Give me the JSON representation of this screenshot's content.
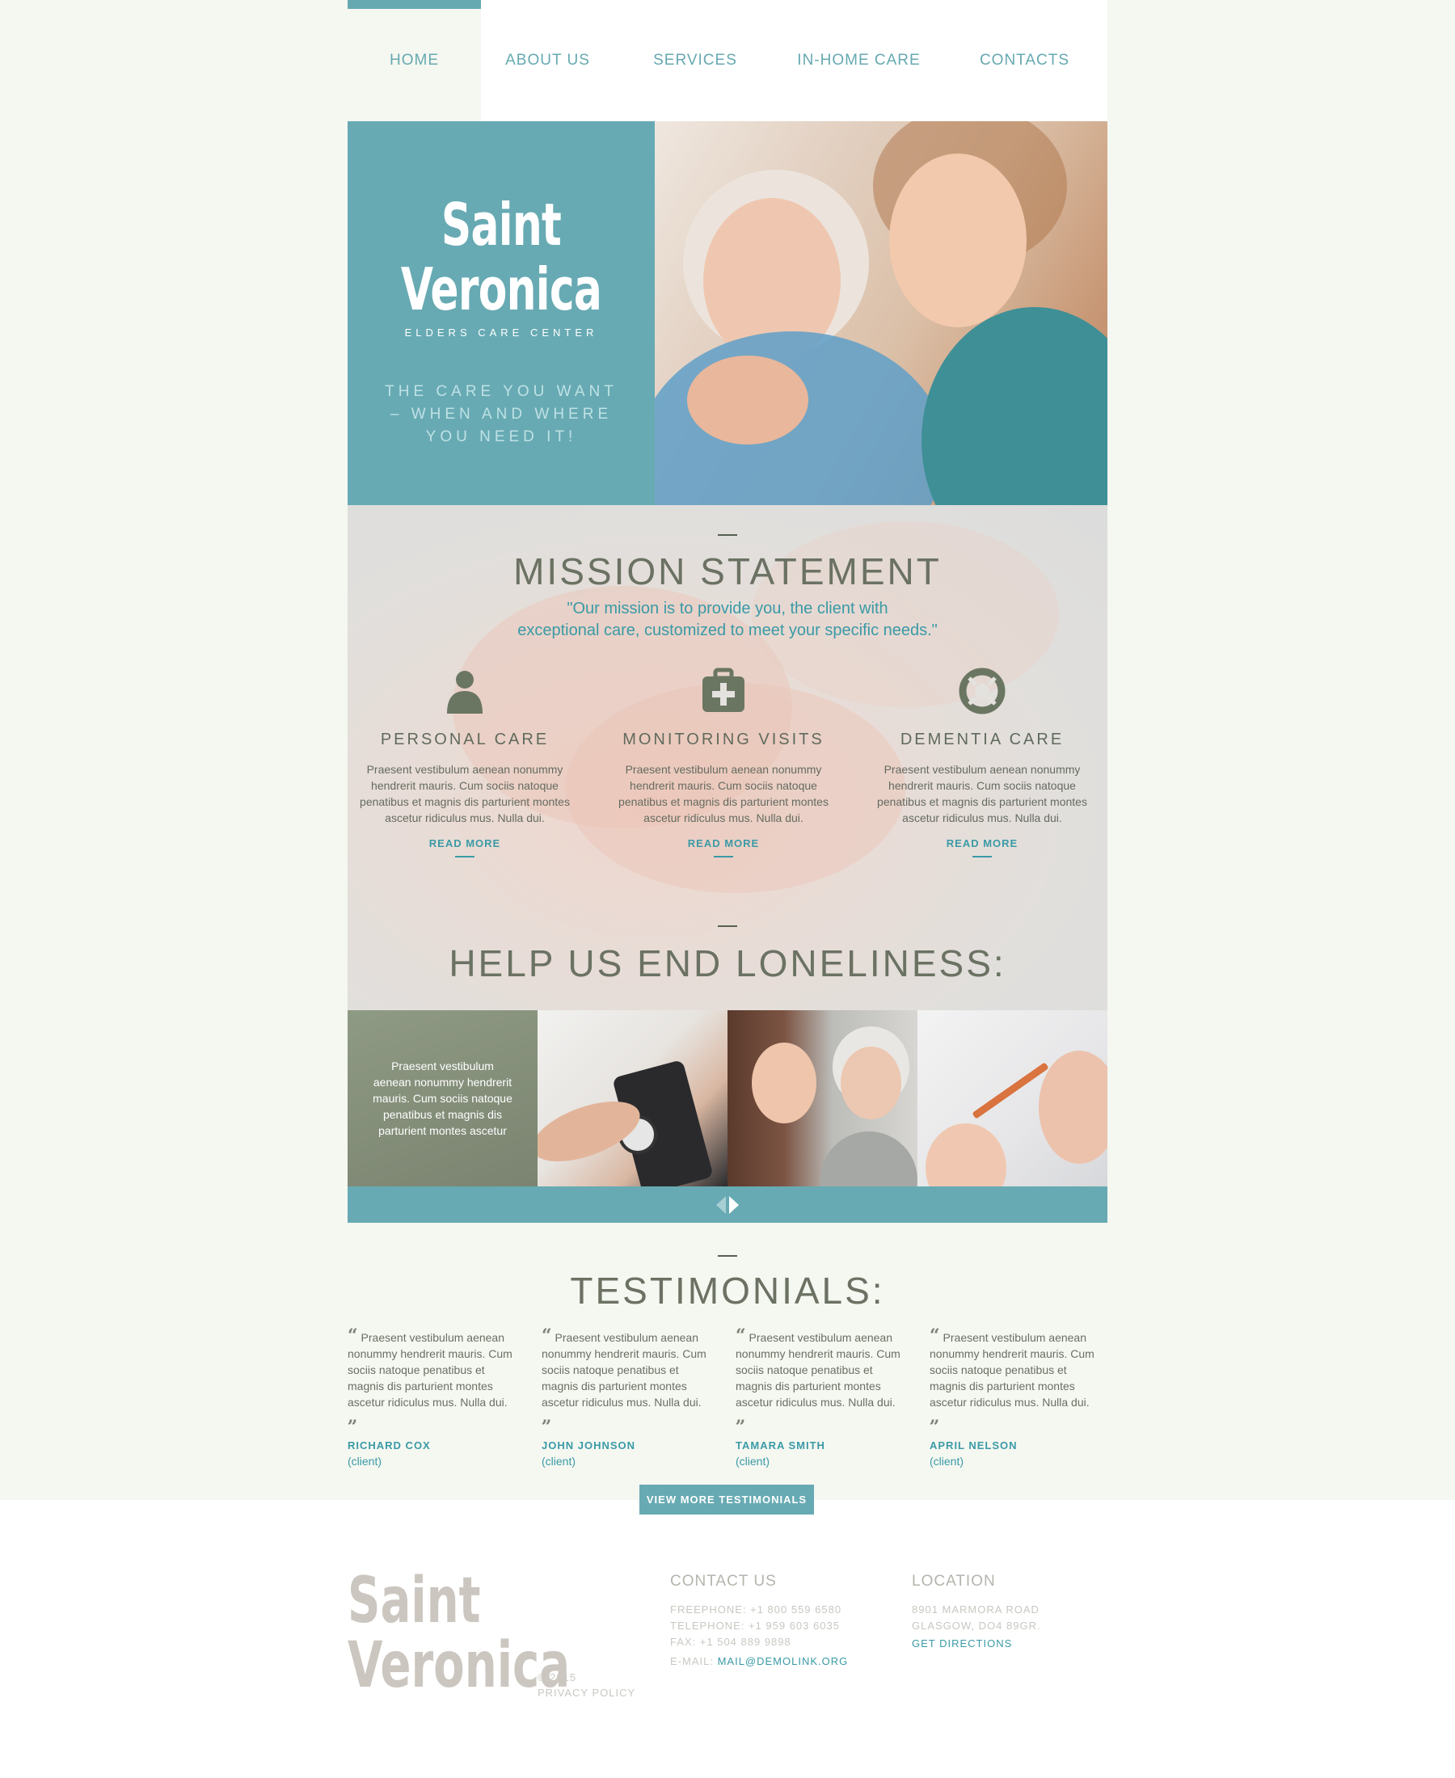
{
  "nav": {
    "items": [
      {
        "label": "HOME"
      },
      {
        "label": "ABOUT US"
      },
      {
        "label": "SERVICES"
      },
      {
        "label": "IN-HOME CARE"
      },
      {
        "label": "CONTACTS"
      }
    ]
  },
  "hero": {
    "brand_line1": "Saint",
    "brand_line2": "Veronica",
    "brand_sub": "ELDERS CARE CENTER",
    "tagline": "THE CARE YOU WANT – WHEN AND WHERE YOU NEED IT!"
  },
  "mission": {
    "title": "MISSION STATEMENT",
    "quote_line1": "\"Our mission is to provide you, the client with",
    "quote_line2": "exceptional care, customized to meet your specific needs.\"",
    "features": [
      {
        "icon": "person-icon",
        "title": "PERSONAL CARE",
        "text": "Praesent vestibulum aenean nonummy hendrerit mauris. Cum sociis natoque penatibus et magnis dis parturient montes ascetur ridiculus mus. Nulla dui.",
        "link": "READ MORE"
      },
      {
        "icon": "medical-kit-icon",
        "title": "MONITORING VISITS",
        "text": "Praesent vestibulum aenean nonummy hendrerit mauris. Cum sociis natoque penatibus et magnis dis parturient montes ascetur ridiculus mus. Nulla dui.",
        "link": "READ MORE"
      },
      {
        "icon": "lifebuoy-icon",
        "title": "DEMENTIA CARE",
        "text": "Praesent vestibulum aenean nonummy hendrerit mauris. Cum sociis natoque penatibus et magnis dis parturient montes ascetur ridiculus mus. Nulla dui.",
        "link": "READ MORE"
      }
    ],
    "loneliness_title": "HELP US END LONELINESS:"
  },
  "gallery": {
    "caption": "Praesent vestibulum aenean nonummy hendrerit mauris. Cum sociis natoque penatibus et magnis dis parturient montes ascetur"
  },
  "testimonials": {
    "title": "TESTIMONIALS:",
    "items": [
      {
        "text": "Praesent vestibulum aenean nonummy hendrerit mauris. Cum sociis natoque penatibus et magnis dis parturient montes ascetur ridiculus mus. Nulla dui.",
        "name": "RICHARD COX",
        "role": "(client)"
      },
      {
        "text": "Praesent vestibulum aenean nonummy hendrerit mauris. Cum sociis natoque penatibus et magnis dis parturient montes ascetur ridiculus mus. Nulla dui.",
        "name": "JOHN JOHNSON",
        "role": "(client)"
      },
      {
        "text": "Praesent vestibulum aenean nonummy hendrerit mauris. Cum sociis natoque penatibus et magnis dis parturient montes ascetur ridiculus mus. Nulla dui.",
        "name": "TAMARA SMITH",
        "role": "(client)"
      },
      {
        "text": "Praesent vestibulum aenean nonummy hendrerit mauris. Cum sociis natoque penatibus et magnis dis parturient montes ascetur ridiculus mus. Nulla dui.",
        "name": "APRIL NELSON",
        "role": "(client)"
      }
    ],
    "button": "VIEW MORE TESTIMONIALS"
  },
  "footer": {
    "brand_line1": "Saint",
    "brand_line2": "Veronica",
    "copyright": "© 2015",
    "privacy": "PRIVACY POLICY",
    "contact_head": "CONTACT US",
    "freephone": "FREEPHONE: +1 800 559 6580",
    "telephone": "TELEPHONE: +1 959 603 6035",
    "fax": "FAX: +1 504 889 9898",
    "email_label": "E-MAIL: ",
    "email": "MAIL@DEMOLINK.ORG",
    "location_head": "LOCATION",
    "address1": "8901 MARMORA ROAD",
    "address2": "GLASGOW, DO4 89GR.",
    "directions": "GET DIRECTIONS"
  },
  "colors": {
    "accent": "#67aab3",
    "accent_text": "#3a9aa6",
    "page_bg": "#f5f7f1"
  }
}
